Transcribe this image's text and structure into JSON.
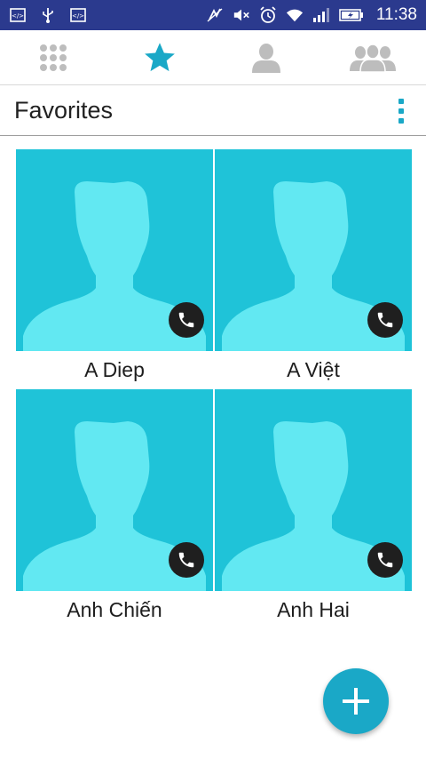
{
  "status_bar": {
    "time": "11:38",
    "battery_color": "#ffffff",
    "background": "#2b3a8e"
  },
  "tabs": [
    {
      "name": "dialpad",
      "icon": "dialpad-icon",
      "selected": false
    },
    {
      "name": "favorites",
      "icon": "star-icon",
      "selected": true
    },
    {
      "name": "contacts",
      "icon": "person-icon",
      "selected": false
    },
    {
      "name": "groups",
      "icon": "group-icon",
      "selected": false
    }
  ],
  "header": {
    "title": "Favorites"
  },
  "favorites": [
    {
      "name": "A Diep"
    },
    {
      "name": "A Việt"
    },
    {
      "name": "Anh Chiến"
    },
    {
      "name": "Anh Hai"
    }
  ],
  "colors": {
    "accent": "#1aa8c7",
    "photo_bg": "#1fc3d8",
    "silhouette": "#62e8f2"
  }
}
